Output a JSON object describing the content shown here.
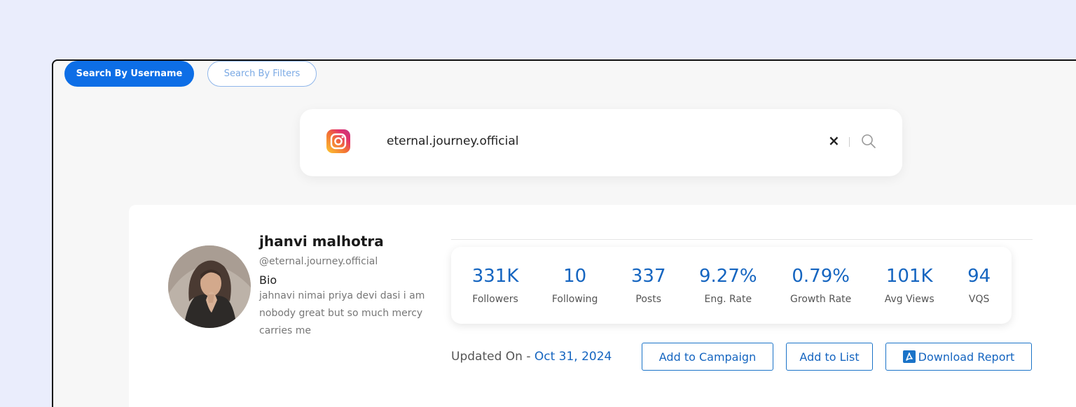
{
  "mode_tabs": [
    {
      "label": "Search By Username",
      "active": true
    },
    {
      "label": "Search By Filters",
      "active": false
    }
  ],
  "search": {
    "platform_icon": "instagram-icon",
    "value": "eternal.journey.official",
    "clear_symbol": "×"
  },
  "profile": {
    "name": "jhanvi malhotra",
    "handle": "@eternal.journey.official",
    "bio_label": "Bio",
    "bio_text": "jahnavi nimai priya devi dasi i am nobody great but so much mercy carries me"
  },
  "stats": [
    {
      "value": "331K",
      "label": "Followers"
    },
    {
      "value": "10",
      "label": "Following"
    },
    {
      "value": "337",
      "label": "Posts"
    },
    {
      "value": "9.27%",
      "label": "Eng. Rate"
    },
    {
      "value": "0.79%",
      "label": "Growth Rate"
    },
    {
      "value": "101K",
      "label": "Avg Views"
    },
    {
      "value": "94",
      "label": "VQS"
    }
  ],
  "updated": {
    "label": "Updated On - ",
    "date": "Oct 31, 2024"
  },
  "actions": {
    "add_to_campaign": "Add to Campaign",
    "add_to_list": "Add to List",
    "download_report": "Download Report"
  },
  "colors": {
    "accent": "#0d6ee6",
    "stat_value": "#1565c0",
    "page_background": "#eaedfc"
  }
}
